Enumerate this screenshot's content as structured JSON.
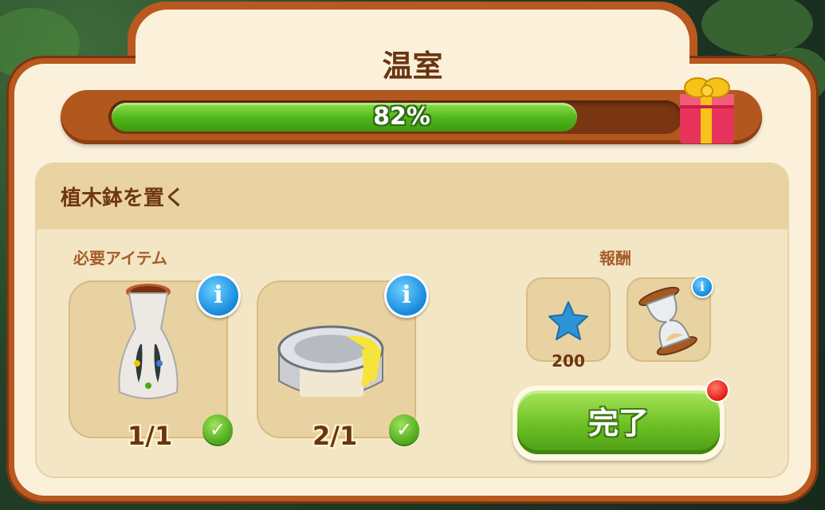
{
  "header": {
    "title": "温室"
  },
  "progress": {
    "percent": 82,
    "label": "82%"
  },
  "task": {
    "title": "植木鉢を置く",
    "required_label": "必要アイテム",
    "reward_label": "報酬",
    "items": [
      {
        "icon": "vase-icon",
        "count": "1/1",
        "complete": true
      },
      {
        "icon": "paint-can-icon",
        "count": "2/1",
        "complete": true
      }
    ],
    "rewards": [
      {
        "icon": "star-icon",
        "amount": "200"
      },
      {
        "icon": "hourglass-icon",
        "amount": ""
      }
    ]
  },
  "actions": {
    "complete_label": "完了"
  },
  "colors": {
    "frame": "#b9581f",
    "panel": "#fbf1da",
    "progress": "#4fb51a",
    "button": "#6cbf24"
  }
}
